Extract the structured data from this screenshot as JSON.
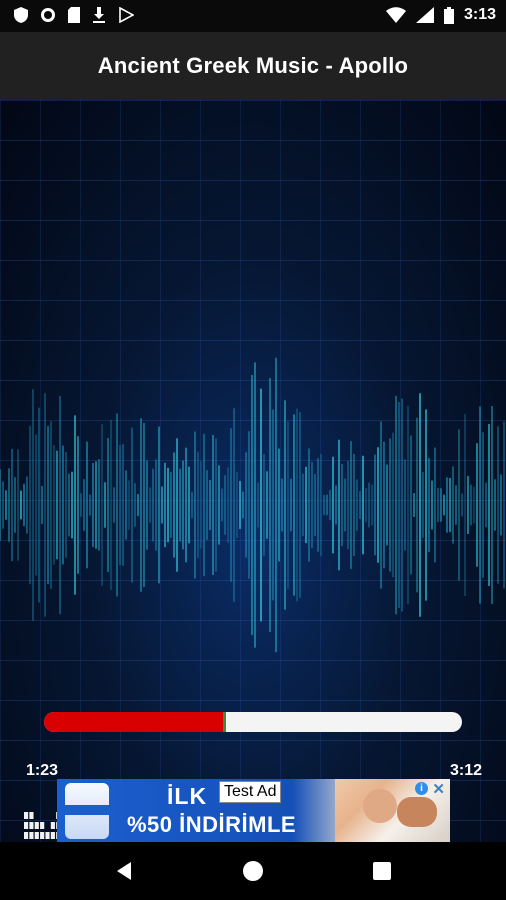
{
  "status_bar": {
    "time": "3:13",
    "icons": [
      "shield-icon",
      "circle-record-icon",
      "sd-card-icon",
      "download-icon",
      "play-store-icon",
      "wifi-icon",
      "signal-icon",
      "battery-icon"
    ]
  },
  "app_bar": {
    "title": "Ancient Greek Music - Apollo"
  },
  "player": {
    "current_time": "1:23",
    "total_time": "3:12",
    "progress": 0.43,
    "equalizer_levels": [
      4,
      4,
      3,
      3,
      2,
      3,
      4,
      3,
      2,
      4,
      3,
      2,
      2,
      1,
      1,
      3,
      2,
      4,
      3,
      2,
      3,
      4,
      3,
      2,
      3,
      1,
      1,
      1
    ]
  },
  "ad": {
    "line1": "İLK",
    "line2": "%50 İNDİRİMLE",
    "badge": "Test Ad",
    "info_label": "i",
    "close_label": "✕"
  },
  "colors": {
    "progress_fill": "#d80000",
    "progress_track": "#f4f4f4",
    "accent_blue": "#2c8ee6"
  }
}
